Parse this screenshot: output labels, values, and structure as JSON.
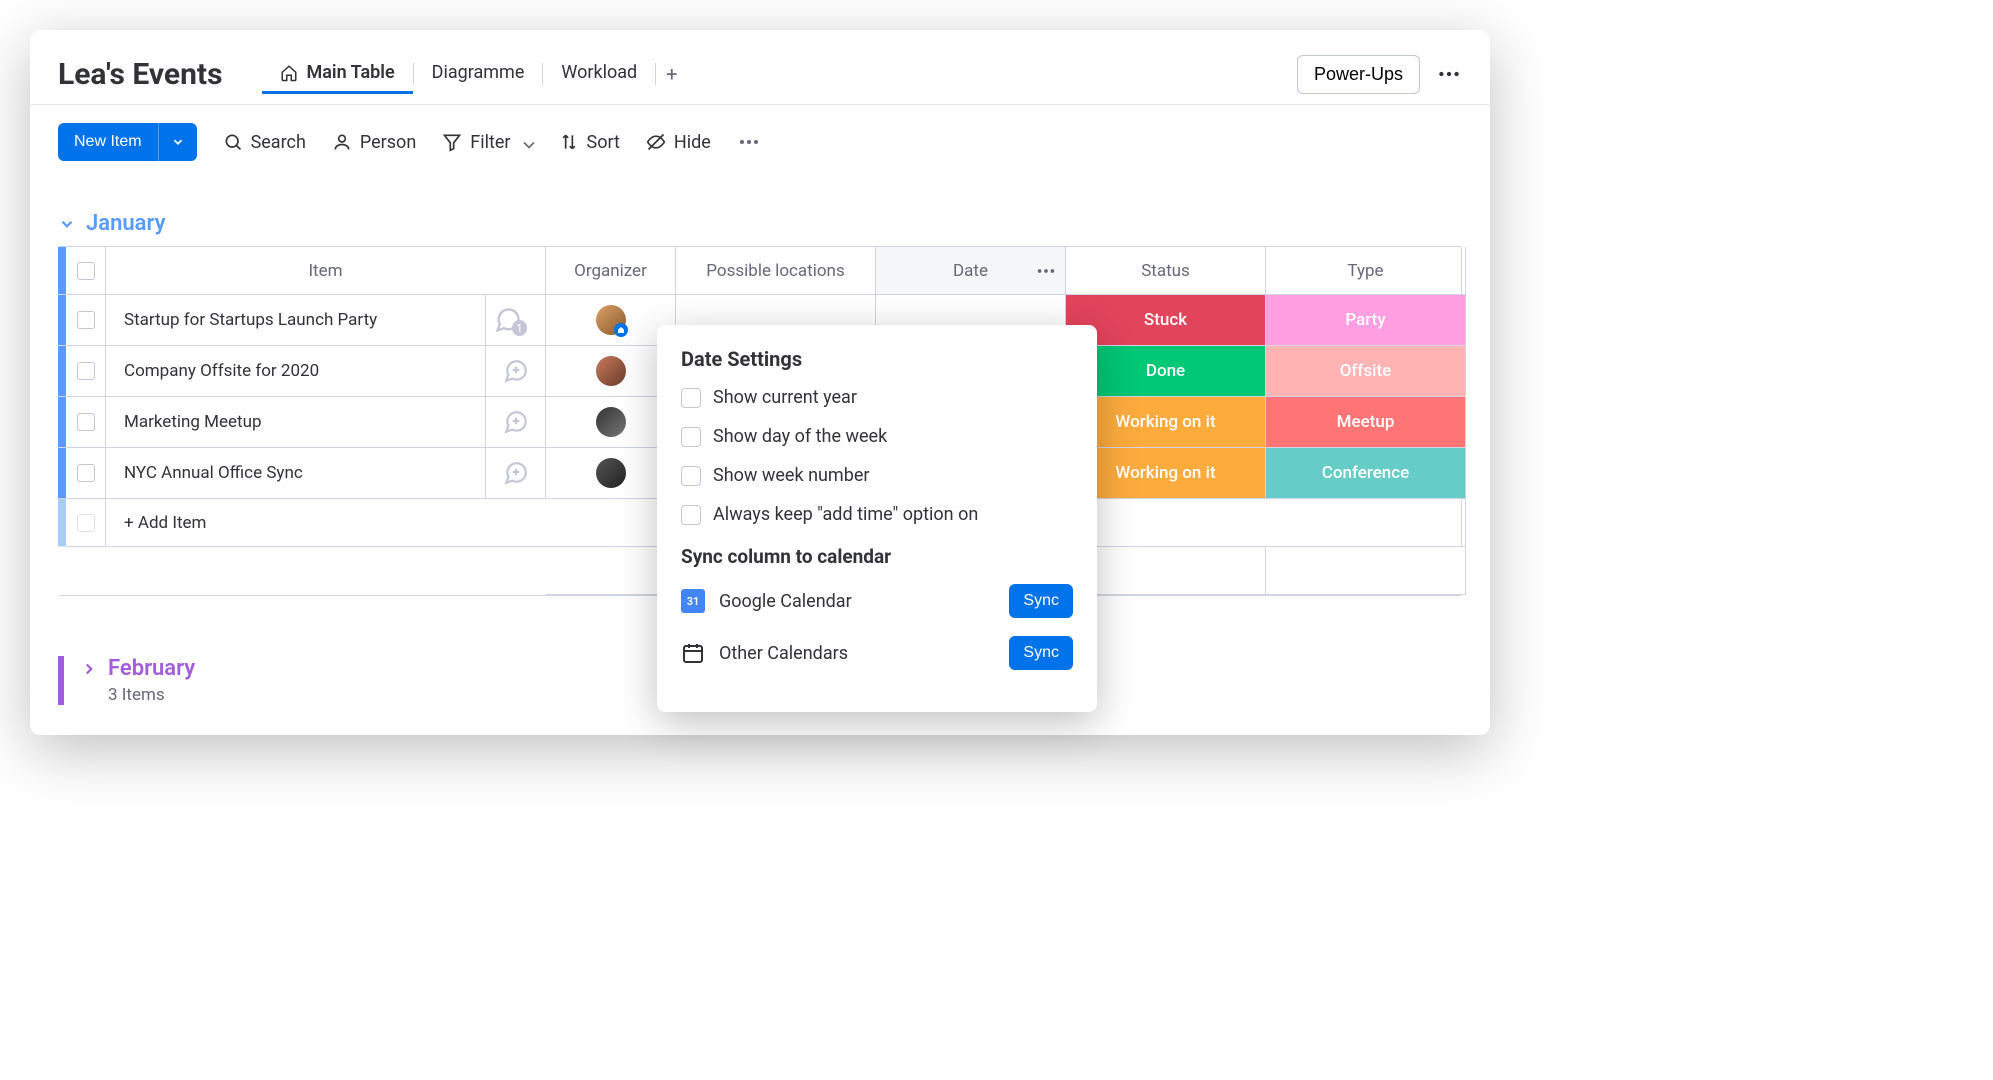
{
  "board": {
    "title": "Lea's Events"
  },
  "tabs": {
    "main": "Main Table",
    "diagramme": "Diagramme",
    "workload": "Workload"
  },
  "header": {
    "powerups": "Power-Ups"
  },
  "toolbar": {
    "new_item": "New Item",
    "search": "Search",
    "person": "Person",
    "filter": "Filter",
    "sort": "Sort",
    "hide": "Hide"
  },
  "group_main": {
    "title": "January"
  },
  "columns": {
    "item": "Item",
    "organizer": "Organizer",
    "locations": "Possible locations",
    "date": "Date",
    "status": "Status",
    "type": "Type"
  },
  "rows": [
    {
      "name": "Startup for Startups Launch Party",
      "chat_count": "1",
      "status": "Stuck",
      "type": "Party"
    },
    {
      "name": "Company Offsite for 2020",
      "status": "Done",
      "type": "Offsite"
    },
    {
      "name": "Marketing Meetup",
      "status": "Working on it",
      "type": "Meetup"
    },
    {
      "name": "NYC Annual Office Sync",
      "status": "Working on it",
      "type": "Conference"
    }
  ],
  "add_item": "+ Add Item",
  "group_collapsed": {
    "title": "February",
    "count": "3 Items"
  },
  "popover": {
    "title": "Date Settings",
    "opts": {
      "year": "Show current year",
      "dow": "Show day of the week",
      "weeknum": "Show week number",
      "addtime": "Always keep \"add time\" option on"
    },
    "sync_title": "Sync column to calendar",
    "gcal": "Google Calendar",
    "gcal_day": "31",
    "other": "Other Calendars",
    "sync_btn": "Sync"
  },
  "colors": {
    "blue_accent": "#579bfc",
    "purple_accent": "#a25ddc",
    "primary": "#0073ea"
  }
}
